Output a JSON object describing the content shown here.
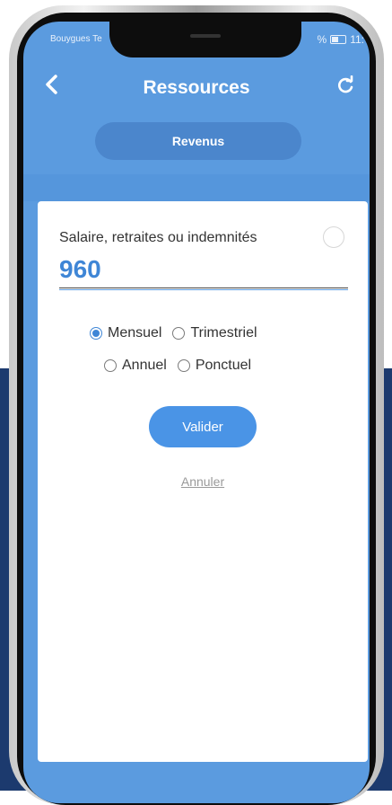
{
  "status_bar": {
    "carrier": "Bouygues Te",
    "battery_text": "%",
    "time": "11:"
  },
  "header": {
    "title": "Ressources",
    "back_icon": "chevron-left-icon",
    "refresh_icon": "refresh-icon"
  },
  "tab": {
    "label": "Revenus"
  },
  "form": {
    "field_label": "Salaire, retraites ou indemnités",
    "field_value": "960",
    "frequency_options": [
      {
        "label": "Mensuel",
        "checked": true
      },
      {
        "label": "Trimestriel",
        "checked": false
      },
      {
        "label": "Annuel",
        "checked": false
      },
      {
        "label": "Ponctuel",
        "checked": false
      }
    ],
    "submit_label": "Valider",
    "cancel_label": "Annuler"
  },
  "colors": {
    "accent": "#4a94e6",
    "header_bg": "#5b9bdf",
    "value_text": "#3f86d6"
  }
}
